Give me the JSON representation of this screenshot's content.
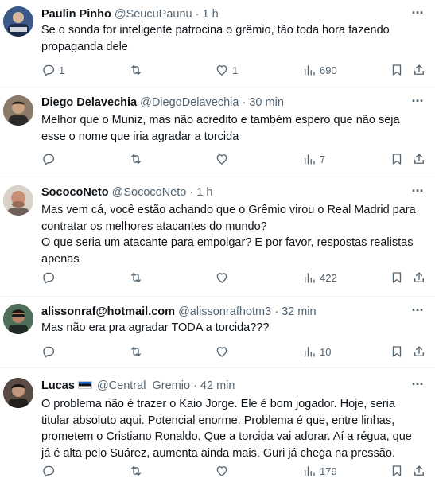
{
  "tweets": [
    {
      "name": "Paulin Pinho",
      "handle": "@SeucuPaunu",
      "sep": "·",
      "time": "1 h",
      "more": "···",
      "text": "Se o sonda for inteligente patrocina o grêmio, tão toda hora fazendo propaganda dele",
      "reply_count": "1",
      "retweet_count": "",
      "like_count": "1",
      "view_count": "690",
      "avatar_color": "#3b5a8a"
    },
    {
      "name": "Diego Delavechia",
      "handle": "@DiegoDelavechia",
      "sep": "·",
      "time": "30 min",
      "more": "···",
      "text": "Melhor que o Muniz, mas não acredito e também espero que não seja esse o nome que iria agradar a torcida",
      "reply_count": "",
      "retweet_count": "",
      "like_count": "",
      "view_count": "7",
      "avatar_color": "#5b4636"
    },
    {
      "name": "SococoNeto",
      "handle": "@SococoNeto",
      "sep": "·",
      "time": "1 h",
      "more": "···",
      "text": "Mas vem cá, você estão achando que o Grêmio virou o Real Madrid para contratar os melhores atacantes do mundo?\nO que seria um atacante para empolgar? E por favor, respostas realistas apenas",
      "reply_count": "",
      "retweet_count": "",
      "like_count": "",
      "view_count": "422",
      "avatar_color": "#b7a08c"
    },
    {
      "name": "alissonraf@hotmail.com",
      "handle": "@alissonrafhotm3",
      "sep": "·",
      "time": "32 min",
      "more": "···",
      "text": "Mas não era pra agradar TODA a torcida???",
      "reply_count": "",
      "retweet_count": "",
      "like_count": "",
      "view_count": "10",
      "avatar_color": "#2f4a3a"
    },
    {
      "name": "Lucas",
      "handle": "@Central_Gremio",
      "sep": "·",
      "time": "42 min",
      "more": "···",
      "text": "O problema não é trazer o Kaio Jorge. Ele é bom jogador. Hoje, seria titular absoluto aqui. Potencial enorme. Problema é que, entre linhas, prometem o Cristiano Ronaldo. Que a torcida vai adorar. Aí a régua, que já é alta pelo Suárez, aumenta ainda mais. Guri já chega na pressão.",
      "reply_count": "",
      "retweet_count": "",
      "like_count": "",
      "view_count": "179",
      "avatar_color": "#3a2e28"
    }
  ],
  "icons": {
    "reply": "reply-icon",
    "retweet": "retweet-icon",
    "like": "heart-icon",
    "views": "views-icon",
    "bookmark": "bookmark-icon",
    "share": "share-icon"
  },
  "colors": {
    "text": "#0f1419",
    "secondary": "#536471",
    "divider": "#eff3f4"
  }
}
